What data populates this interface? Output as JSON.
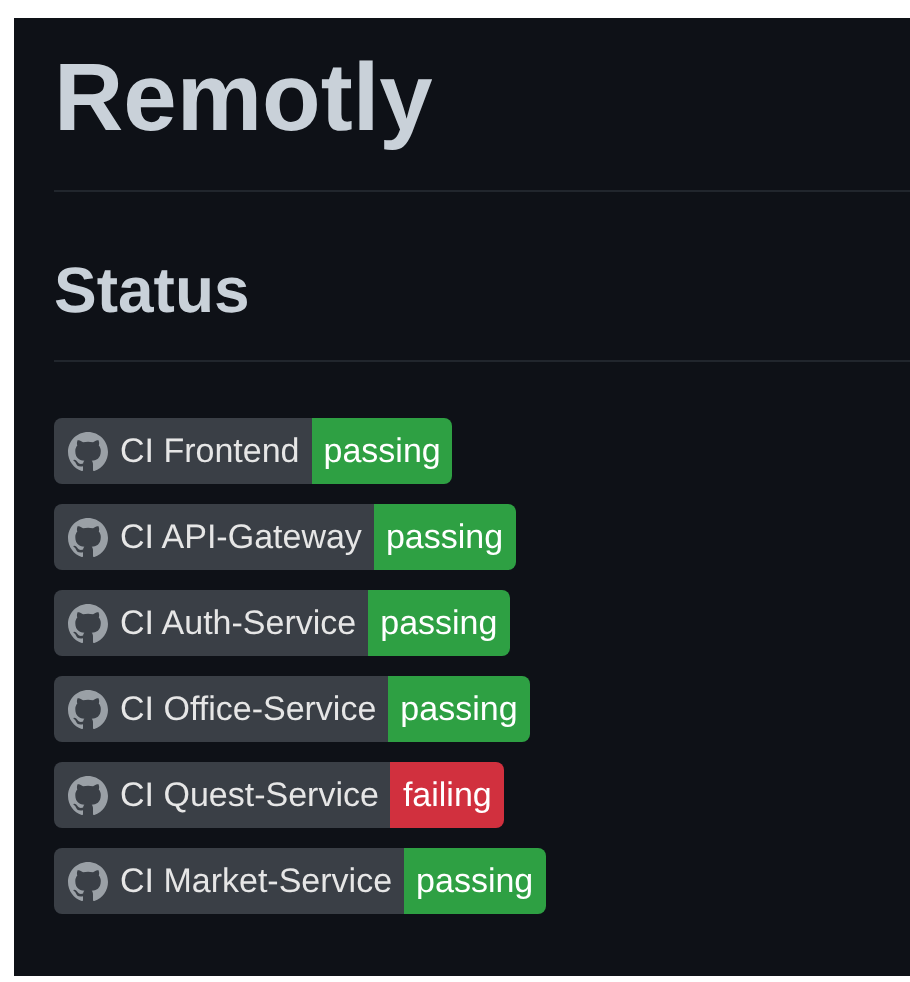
{
  "title": "Remotly",
  "section_heading": "Status",
  "badges": [
    {
      "label": "CI Frontend",
      "status": "passing",
      "color": "#2ea043"
    },
    {
      "label": "CI API-Gateway",
      "status": "passing",
      "color": "#2ea043"
    },
    {
      "label": "CI Auth-Service",
      "status": "passing",
      "color": "#2ea043"
    },
    {
      "label": "CI Office-Service",
      "status": "passing",
      "color": "#2ea043"
    },
    {
      "label": "CI Quest-Service",
      "status": "failing",
      "color": "#d1303e"
    },
    {
      "label": "CI Market-Service",
      "status": "passing",
      "color": "#2ea043"
    }
  ]
}
